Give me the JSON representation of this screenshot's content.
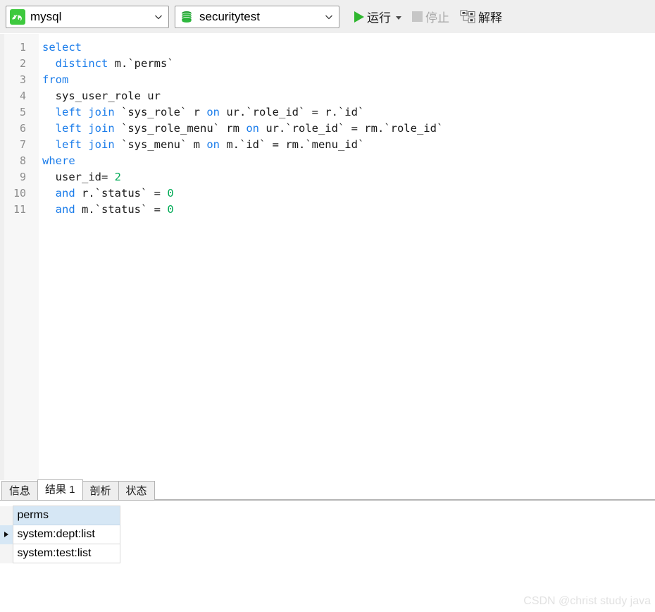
{
  "toolbar": {
    "connection": {
      "icon": "mysql-dolphin-icon",
      "value": "mysql",
      "caret": "chevron-down-icon"
    },
    "database": {
      "icon": "database-cylinder-icon",
      "value": "securitytest",
      "caret": "chevron-down-icon"
    },
    "run": {
      "label": "运行",
      "icon": "play-icon",
      "caret": "dropdown-caret-icon",
      "enabled": true
    },
    "stop": {
      "label": "停止",
      "icon": "stop-square-icon",
      "enabled": false
    },
    "explain": {
      "label": "解释",
      "icon": "explain-plan-icon",
      "enabled": true
    }
  },
  "editor": {
    "language": "sql",
    "lines": [
      {
        "no": "1",
        "tokens": [
          {
            "t": "select",
            "c": "kw"
          }
        ]
      },
      {
        "no": "2",
        "tokens": [
          {
            "t": "  ",
            "c": "p"
          },
          {
            "t": "distinct",
            "c": "kw"
          },
          {
            "t": " m.`perms`",
            "c": "p"
          }
        ]
      },
      {
        "no": "3",
        "tokens": [
          {
            "t": "from",
            "c": "kw"
          }
        ]
      },
      {
        "no": "4",
        "tokens": [
          {
            "t": "  sys_user_role ur",
            "c": "p"
          }
        ]
      },
      {
        "no": "5",
        "tokens": [
          {
            "t": "  ",
            "c": "p"
          },
          {
            "t": "left join",
            "c": "kw"
          },
          {
            "t": " `sys_role` r ",
            "c": "p"
          },
          {
            "t": "on",
            "c": "kw"
          },
          {
            "t": " ur.`role_id` = r.`id`",
            "c": "p"
          }
        ]
      },
      {
        "no": "6",
        "tokens": [
          {
            "t": "  ",
            "c": "p"
          },
          {
            "t": "left join",
            "c": "kw"
          },
          {
            "t": " `sys_role_menu` rm ",
            "c": "p"
          },
          {
            "t": "on",
            "c": "kw"
          },
          {
            "t": " ur.`role_id` = rm.`role_id`",
            "c": "p"
          }
        ]
      },
      {
        "no": "7",
        "tokens": [
          {
            "t": "  ",
            "c": "p"
          },
          {
            "t": "left join",
            "c": "kw"
          },
          {
            "t": " `sys_menu` m ",
            "c": "p"
          },
          {
            "t": "on",
            "c": "kw"
          },
          {
            "t": " m.`id` = rm.`menu_id`",
            "c": "p"
          }
        ]
      },
      {
        "no": "8",
        "tokens": [
          {
            "t": "where",
            "c": "kw"
          }
        ]
      },
      {
        "no": "9",
        "tokens": [
          {
            "t": "  user_id= ",
            "c": "p"
          },
          {
            "t": "2",
            "c": "num"
          }
        ]
      },
      {
        "no": "10",
        "tokens": [
          {
            "t": "  ",
            "c": "p"
          },
          {
            "t": "and",
            "c": "kw"
          },
          {
            "t": " r.`status` = ",
            "c": "p"
          },
          {
            "t": "0",
            "c": "num"
          }
        ]
      },
      {
        "no": "11",
        "tokens": [
          {
            "t": "  ",
            "c": "p"
          },
          {
            "t": "and",
            "c": "kw"
          },
          {
            "t": " m.`status` = ",
            "c": "p"
          },
          {
            "t": "0",
            "c": "num"
          }
        ]
      }
    ]
  },
  "results": {
    "tabs": [
      {
        "label": "信息",
        "active": false
      },
      {
        "label": "结果 1",
        "active": true
      },
      {
        "label": "剖析",
        "active": false
      },
      {
        "label": "状态",
        "active": false
      }
    ],
    "grid": {
      "columns": [
        "perms"
      ],
      "rows": [
        {
          "selected": true,
          "cells": [
            "system:dept:list"
          ]
        },
        {
          "selected": false,
          "cells": [
            "system:test:list"
          ]
        }
      ]
    }
  },
  "watermark": "CSDN @christ study java",
  "colors": {
    "toolbar_bg": "#efefef",
    "keyword": "#1a7cea",
    "number": "#00aa55",
    "accent_green": "#2fb62f",
    "grid_header_bg": "#d6e7f5"
  }
}
